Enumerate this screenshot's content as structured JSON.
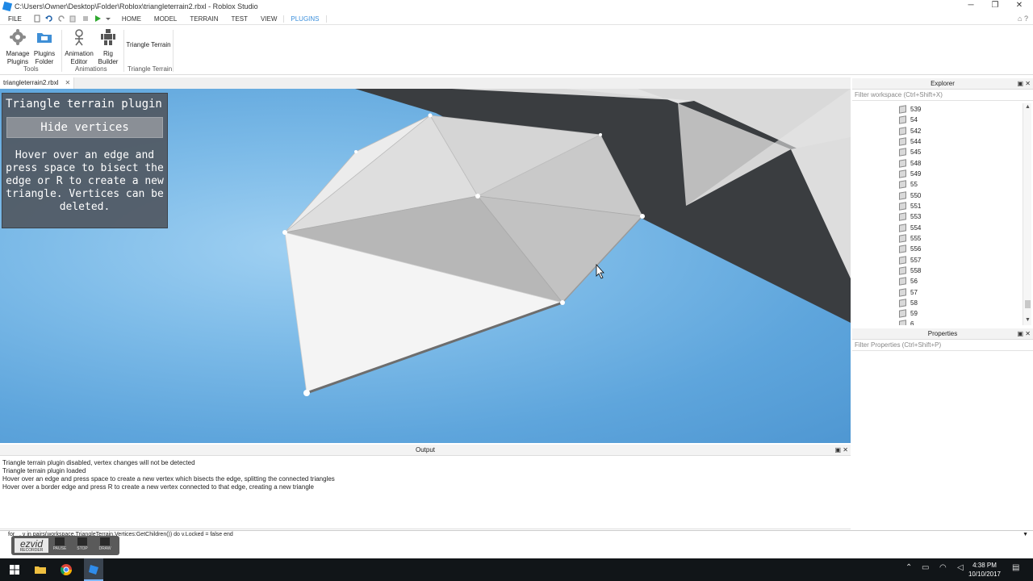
{
  "window": {
    "title": "C:\\Users\\Owner\\Desktop\\Folder\\Roblox\\triangleterrain2.rbxl - Roblox Studio",
    "minimize": "─",
    "maximize": "❐",
    "close": "✕"
  },
  "menubar": {
    "file": "FILE",
    "tabs": [
      "HOME",
      "MODEL",
      "TERRAIN",
      "TEST",
      "VIEW",
      "PLUGINS"
    ],
    "active_tab": "PLUGINS"
  },
  "ribbon": {
    "manage_plugins": "Manage Plugins",
    "plugins_folder": "Plugins Folder",
    "animation_editor": "Animation Editor",
    "rig_builder": "Rig Builder",
    "triangle_terrain": "Triangle Terrain",
    "group_tools": "Tools",
    "group_animations": "Animations",
    "group_triangle": "Triangle Terrain"
  },
  "document_tab": {
    "label": "triangleterrain2.rbxl",
    "close": "✕"
  },
  "plugin_panel": {
    "title": "Triangle terrain plugin",
    "button": "Hide vertices",
    "description": "Hover over an edge and press space to bisect the edge or R to create a new triangle. Vertices can be deleted."
  },
  "explorer": {
    "title": "Explorer",
    "filter_placeholder": "Filter workspace (Ctrl+Shift+X)",
    "items": [
      "539",
      "54",
      "542",
      "544",
      "545",
      "548",
      "549",
      "55",
      "550",
      "551",
      "553",
      "554",
      "555",
      "556",
      "557",
      "558",
      "56",
      "57",
      "58",
      "59",
      "6"
    ]
  },
  "properties": {
    "title": "Properties",
    "filter_placeholder": "Filter Properties (Ctrl+Shift+P)"
  },
  "output": {
    "title": "Output",
    "lines": [
      "Triangle terrain plugin disabled, vertex changes will not be detected",
      "Triangle terrain plugin loaded",
      "Hover over an edge and press space to create a new vertex which bisects the edge, splitting the connected triangles",
      "Hover over a border edge and press R to create a new vertex connected to that edge, creating a new triangle"
    ]
  },
  "command_bar": {
    "text": "for _, v in pairs(workspace.TriangleTerrain.Vertices:GetChildren()) do v.Locked = false end"
  },
  "ezvid": {
    "logo": "ezvid",
    "sub": "RECORDER",
    "pause": "PAUSE",
    "stop": "STOP",
    "draw": "DRAW"
  },
  "taskbar": {
    "time": "4:38 PM",
    "date": "10/10/2017"
  },
  "colors": {
    "accent": "#3b8fdc",
    "sky": "#7dbbe8",
    "panel": "#505862"
  }
}
